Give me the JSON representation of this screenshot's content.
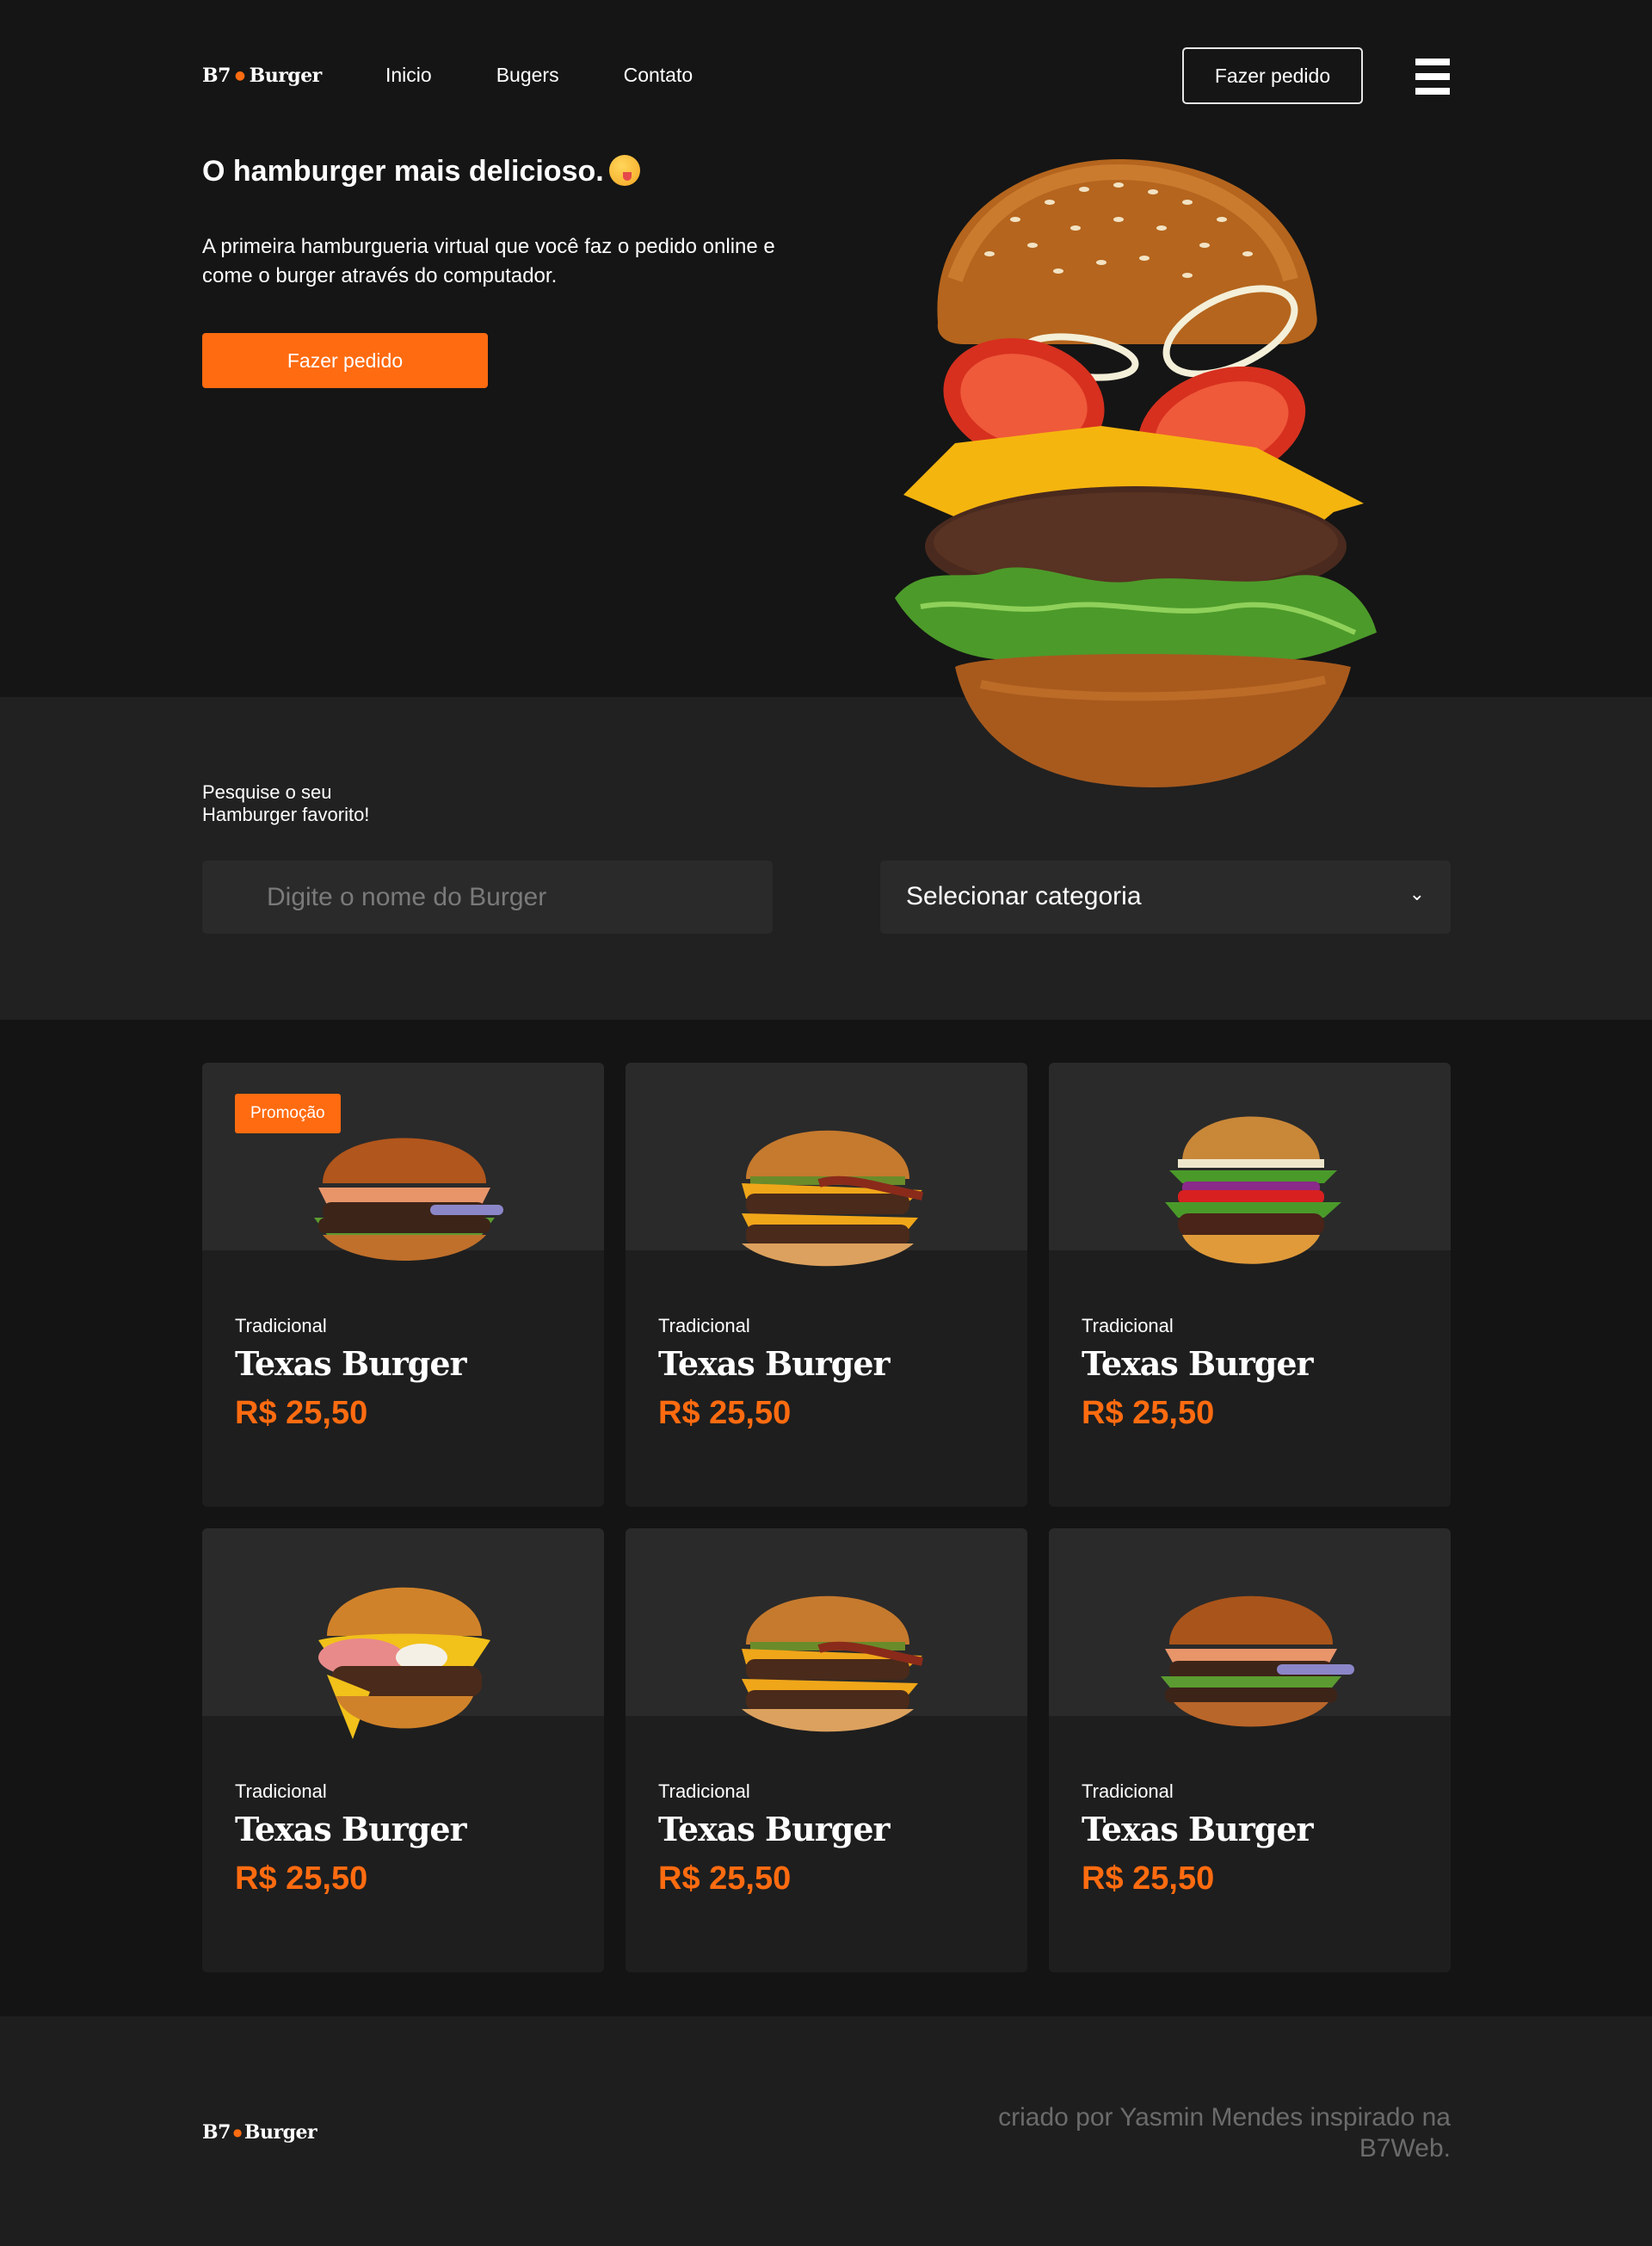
{
  "header": {
    "logo_text": "B7",
    "logo_text2": "Burger",
    "nav": [
      "Inicio",
      "Bugers",
      "Contato"
    ],
    "order_button": "Fazer pedido"
  },
  "hero": {
    "title": "O hamburger mais delicioso.",
    "description": "A primeira hamburgueria virtual que você faz o pedido online e come o burger através do computador.",
    "cta": "Fazer pedido"
  },
  "search": {
    "label_line1": "Pesquise o seu",
    "label_line2": "Hamburger favorito!",
    "placeholder": "Digite o nome do Burger",
    "select_value": "Selecionar categoria"
  },
  "products": [
    {
      "badge": "Promoção",
      "category": "Tradicional",
      "name": "Texas Burger",
      "price": "R$ 25,50"
    },
    {
      "badge": "",
      "category": "Tradicional",
      "name": "Texas Burger",
      "price": "R$ 25,50"
    },
    {
      "badge": "",
      "category": "Tradicional",
      "name": "Texas Burger",
      "price": "R$ 25,50"
    },
    {
      "badge": "",
      "category": "Tradicional",
      "name": "Texas Burger",
      "price": "R$ 25,50"
    },
    {
      "badge": "",
      "category": "Tradicional",
      "name": "Texas Burger",
      "price": "R$ 25,50"
    },
    {
      "badge": "",
      "category": "Tradicional",
      "name": "Texas Burger",
      "price": "R$ 25,50"
    }
  ],
  "footer": {
    "logo_text": "B7",
    "logo_text2": "Burger",
    "credit": "criado por Yasmin Mendes inspirado na B7Web."
  },
  "colors": {
    "accent": "#ff6b10",
    "background": "#151515",
    "panel": "#212121",
    "card": "#1e1e1e"
  }
}
